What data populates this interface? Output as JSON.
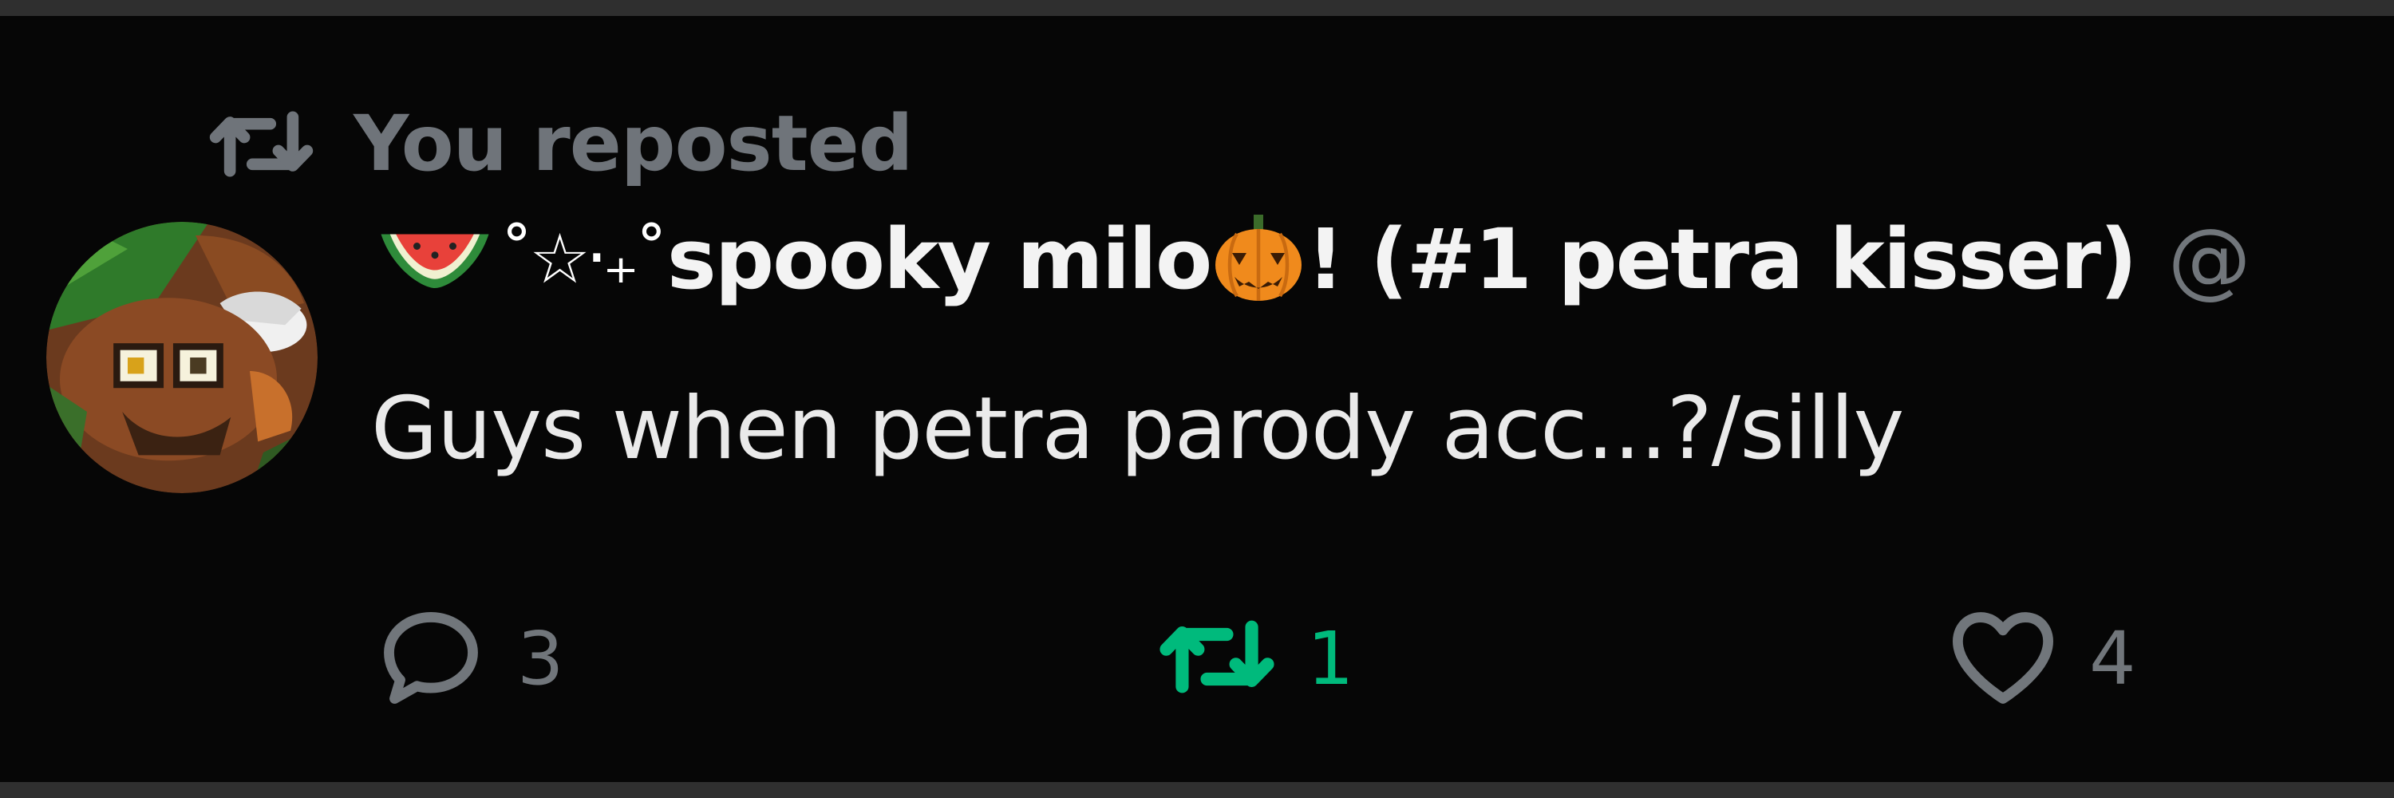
{
  "repost_banner": {
    "label": "You reposted",
    "icon": "repost-icon"
  },
  "author": {
    "prefix_emoji": "watermelon-icon",
    "sparkle": "˚☆‧₊˚",
    "name": "spooky milo",
    "suffix_emoji": "pumpkin-icon",
    "name_tail": "! (#1 petra kisser)",
    "handle_partial": "@"
  },
  "post": {
    "text": "Guys when petra parody acc...?/silly"
  },
  "actions": {
    "reply_count": "3",
    "repost_count": "1",
    "like_count": "4"
  },
  "colors": {
    "background": "#060606",
    "muted": "#71767b",
    "repost_active": "#00ba7c",
    "text": "#eaeaea"
  }
}
